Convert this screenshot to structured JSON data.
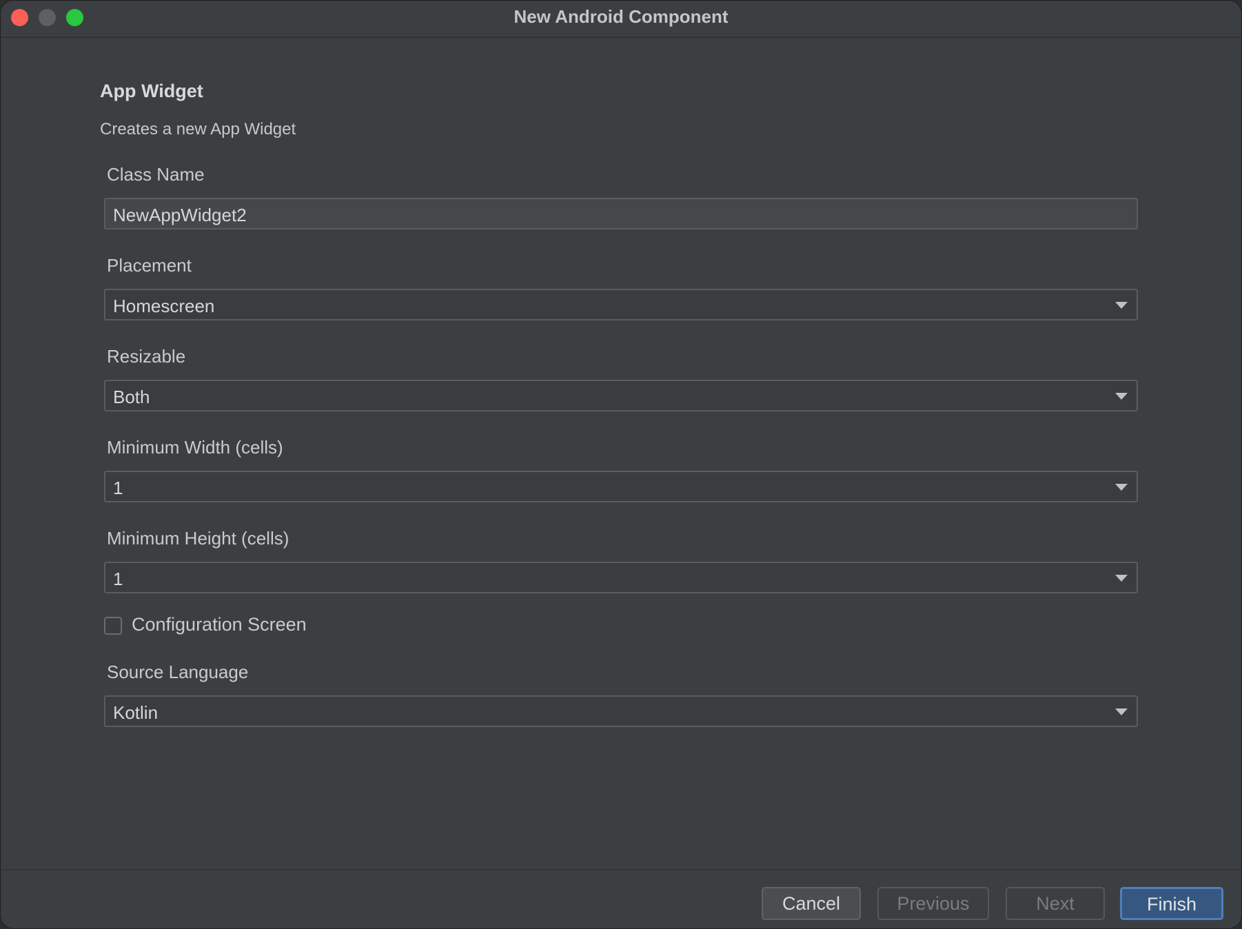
{
  "window": {
    "title": "New Android Component"
  },
  "header": {
    "heading": "App Widget",
    "subtitle": "Creates a new App Widget"
  },
  "fields": {
    "class_name": {
      "label": "Class Name",
      "value": "NewAppWidget2"
    },
    "placement": {
      "label": "Placement",
      "value": "Homescreen"
    },
    "resizable": {
      "label": "Resizable",
      "value": "Both"
    },
    "min_width": {
      "label": "Minimum Width (cells)",
      "value": "1"
    },
    "min_height": {
      "label": "Minimum Height (cells)",
      "value": "1"
    },
    "configuration_screen": {
      "label": "Configuration Screen",
      "checked": false
    },
    "source_language": {
      "label": "Source Language",
      "value": "Kotlin"
    }
  },
  "footer": {
    "cancel_label": "Cancel",
    "previous_label": "Previous",
    "next_label": "Next",
    "finish_label": "Finish"
  },
  "colors": {
    "background": "#3c3f41",
    "primary_button": "#365880",
    "close": "#fe5f57",
    "maximize": "#29c840"
  }
}
